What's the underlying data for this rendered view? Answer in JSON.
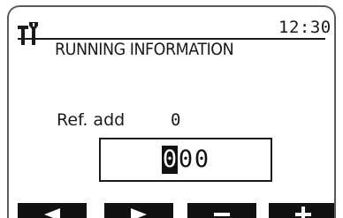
{
  "header": {
    "time": "12:30",
    "title": "RUNNING INFORMATION",
    "icon": "maintenance-tools-icon"
  },
  "main": {
    "ref_label": "Ref. add",
    "ref_value": "0",
    "entry_digits": [
      "0",
      "0",
      "0"
    ],
    "cursor_index": 0
  },
  "softkeys": [
    {
      "icon": "left-arrow-icon"
    },
    {
      "icon": "right-arrow-icon"
    },
    {
      "icon": "minus-icon"
    },
    {
      "icon": "plus-icon"
    }
  ],
  "colors": {
    "background": "#ffffff",
    "text": "#1a1a1a",
    "softkey": "#111111",
    "frame": "#5a5a5a"
  }
}
